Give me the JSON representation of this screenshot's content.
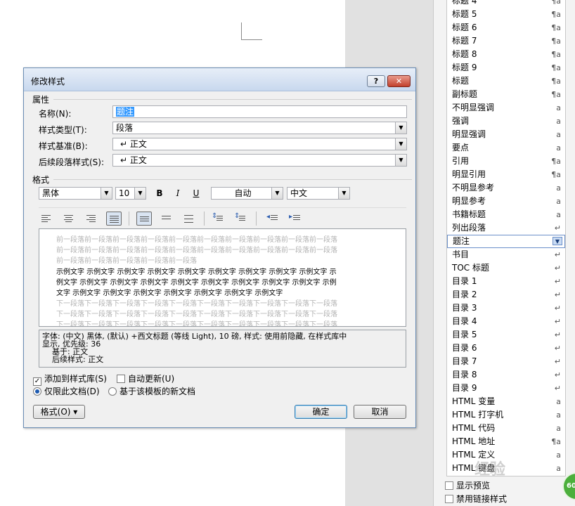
{
  "dialog": {
    "title": "修改样式",
    "help_label": "?",
    "close_label": "✕",
    "properties_group": "属性",
    "name_label": "名称(N):",
    "name_value": "题注",
    "style_type_label": "样式类型(T):",
    "style_type_value": "段落",
    "based_on_label": "样式基准(B):",
    "based_on_value": "↵ 正文",
    "next_style_label": "后续段落样式(S):",
    "next_style_value": "↵ 正文",
    "format_group": "格式",
    "font_value": "黑体",
    "size_value": "10",
    "bold_label": "B",
    "italic_label": "I",
    "underline_label": "U",
    "color_value": "自动",
    "script_value": "中文",
    "preview": {
      "prev_lines": [
        "前一段落前一段落前一段落前一段落前一段落前一段落前一段落前一段落前一段落前一段落",
        "前一段落前一段落前一段落前一段落前一段落前一段落前一段落前一段落前一段落前一段落",
        "前一段落前一段落前一段落前一段落前一段落"
      ],
      "sample_lines": [
        "示例文字 示例文字 示例文字 示例文字 示例文字 示例文字 示例文字 示例文字 示例文字 示",
        "例文字 示例文字 示例文字 示例文字 示例文字 示例文字 示例文字 示例文字 示例文字 示例",
        "文字 示例文字 示例文字 示例文字 示例文字 示例文字 示例文字 示例文字"
      ],
      "next_lines": [
        "下一段落下一段落下一段落下一段落下一段落下一段落下一段落下一段落下一段落下一段落",
        "下一段落下一段落下一段落下一段落下一段落下一段落下一段落下一段落下一段落下一段落",
        "下一段落下一段落下一段落下一段落下一段落下一段落下一段落下一段落下一段落下一段落",
        "下一段落下一段落下一段落下一段落下一段落下一段落下一段落下一段落下一段落下一段落"
      ]
    },
    "description": [
      "字体: (中文) 黑体, (默认) +西文标题 (等线 Light), 10 磅, 样式: 使用前隐藏, 在样式库中",
      "显示, 优先级: 36",
      "    基于: 正文",
      "    后续样式: 正文"
    ],
    "add_to_gallery_label": "添加到样式库(S)",
    "auto_update_label": "自动更新(U)",
    "only_this_doc_label": "仅限此文档(D)",
    "new_docs_template_label": "基于该模板的新文档",
    "format_button_label": "格式(O) ▾",
    "ok_label": "确定",
    "cancel_label": "取消"
  },
  "styles_pane": {
    "items": [
      {
        "label": "标题 4",
        "mark": "¶a"
      },
      {
        "label": "标题 5",
        "mark": "¶a"
      },
      {
        "label": "标题 6",
        "mark": "¶a"
      },
      {
        "label": "标题 7",
        "mark": "¶a"
      },
      {
        "label": "标题 8",
        "mark": "¶a"
      },
      {
        "label": "标题 9",
        "mark": "¶a"
      },
      {
        "label": "标题",
        "mark": "¶a"
      },
      {
        "label": "副标题",
        "mark": "¶a"
      },
      {
        "label": "不明显强调",
        "mark": "a"
      },
      {
        "label": "强调",
        "mark": "a"
      },
      {
        "label": "明显强调",
        "mark": "a"
      },
      {
        "label": "要点",
        "mark": "a"
      },
      {
        "label": "引用",
        "mark": "¶a"
      },
      {
        "label": "明显引用",
        "mark": "¶a"
      },
      {
        "label": "不明显参考",
        "mark": "a"
      },
      {
        "label": "明显参考",
        "mark": "a"
      },
      {
        "label": "书籍标题",
        "mark": "a"
      },
      {
        "label": "列出段落",
        "mark": "↵"
      },
      {
        "label": "题注",
        "mark": "▼"
      },
      {
        "label": "书目",
        "mark": "↵"
      },
      {
        "label": "TOC 标题",
        "mark": "↵"
      },
      {
        "label": "目录 1",
        "mark": "↵"
      },
      {
        "label": "目录 2",
        "mark": "↵"
      },
      {
        "label": "目录 3",
        "mark": "↵"
      },
      {
        "label": "目录 4",
        "mark": "↵"
      },
      {
        "label": "目录 5",
        "mark": "↵"
      },
      {
        "label": "目录 6",
        "mark": "↵"
      },
      {
        "label": "目录 7",
        "mark": "↵"
      },
      {
        "label": "目录 8",
        "mark": "↵"
      },
      {
        "label": "目录 9",
        "mark": "↵"
      },
      {
        "label": "HTML 变量",
        "mark": "a"
      },
      {
        "label": "HTML 打字机",
        "mark": "a"
      },
      {
        "label": "HTML 代码",
        "mark": "a"
      },
      {
        "label": "HTML 地址",
        "mark": "¶a"
      },
      {
        "label": "HTML 定义",
        "mark": "a"
      },
      {
        "label": "HTML 键盘",
        "mark": "a"
      }
    ],
    "selected_index": 18,
    "show_preview_label": "显示预览",
    "disable_linked_label": "禁用链接样式"
  },
  "badge_text": "60",
  "watermark_text": "经验"
}
